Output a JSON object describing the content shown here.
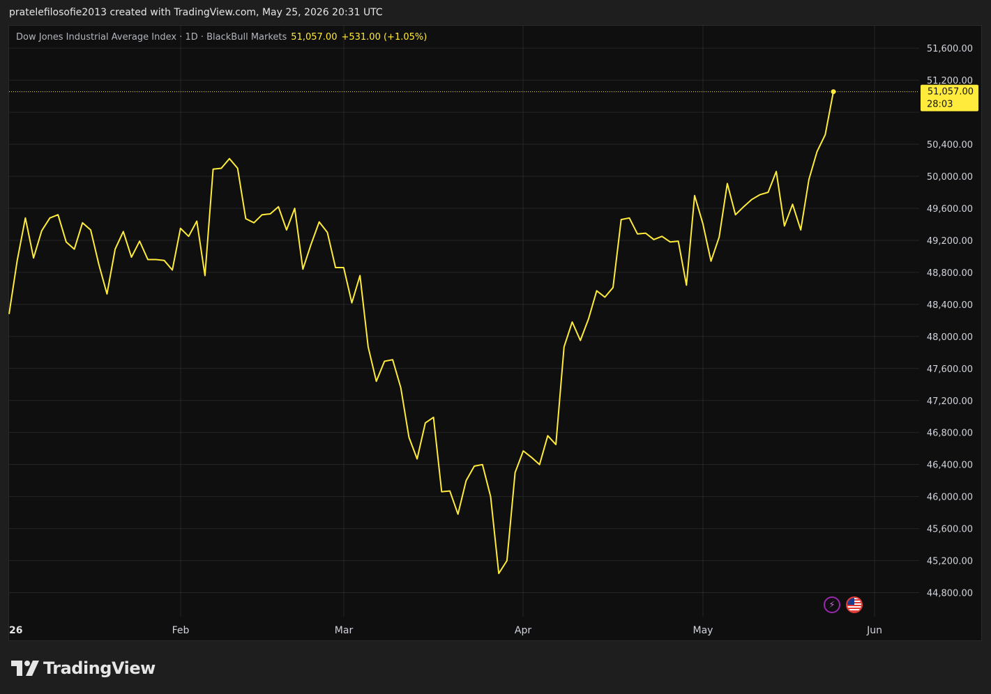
{
  "header": {
    "attribution": "pratelefilosofie2013 created with TradingView.com, May 25, 2026 20:31 UTC"
  },
  "legend": {
    "symbol": "Dow Jones Industrial Average Index · 1D · BlackBull Markets",
    "last": "51,057.00",
    "change": "+531.00 (+1.05%)"
  },
  "price_tag": {
    "value": "51,057.00",
    "countdown": "28:03"
  },
  "footer": {
    "brand": "TradingView"
  },
  "colors": {
    "line": "#ffeb3b",
    "background": "#0f0f0f",
    "grid": "#262626",
    "axis_text": "#d1d4dc"
  },
  "icons": [
    "lightning-icon",
    "us-flag-icon",
    "tradingview-logo-icon"
  ],
  "chart_data": {
    "type": "line",
    "series": [
      {
        "values": [
          48280,
          48950,
          49480,
          48980,
          49320,
          49480,
          49520,
          49180,
          49090,
          49420,
          49330,
          48900,
          48530,
          49090,
          49310,
          48990,
          49190,
          48960,
          48960,
          48950,
          48830,
          49350,
          49250,
          49440,
          48760,
          50090,
          50100,
          50220,
          50100,
          49470,
          49420,
          49520,
          49530,
          49620,
          49330,
          49600,
          48840,
          49150,
          49430,
          49300,
          48860,
          48860,
          48420,
          48760,
          47870,
          47440,
          47690,
          47710,
          47360,
          46740,
          46470,
          46920,
          46990,
          46060,
          46070,
          45780,
          46200,
          46380,
          46400,
          46000,
          45040,
          45200,
          46300,
          46570,
          46490,
          46400,
          46760,
          46650,
          47870,
          48180,
          47950,
          48220,
          48570,
          48490,
          48610,
          49460,
          49480,
          49280,
          49290,
          49210,
          49250,
          49180,
          49190,
          48640,
          49760,
          49410,
          48940,
          49240,
          49910,
          49520,
          49620,
          49710,
          49770,
          49800,
          50060,
          49380,
          49650,
          49330,
          49960,
          50310,
          50520,
          51057
        ]
      }
    ],
    "x_tick_labels": [
      "26",
      "Feb",
      "Mar",
      "Apr",
      "May",
      "Jun"
    ],
    "y_tick_labels": [
      "44,800.00",
      "45,200.00",
      "45,600.00",
      "46,000.00",
      "46,400.00",
      "46,800.00",
      "47,200.00",
      "47,600.00",
      "48,000.00",
      "48,400.00",
      "48,800.00",
      "49,200.00",
      "49,600.00",
      "50,000.00",
      "50,400.00",
      "51,200.00",
      "51,600.00"
    ],
    "y_ticks": [
      44800,
      45200,
      45600,
      46000,
      46400,
      46800,
      47200,
      47600,
      48000,
      48400,
      48800,
      49200,
      49600,
      50000,
      50400,
      50800,
      51200,
      51600
    ],
    "ylim": [
      44500,
      51880
    ],
    "last_value": 51057,
    "grid": true
  }
}
